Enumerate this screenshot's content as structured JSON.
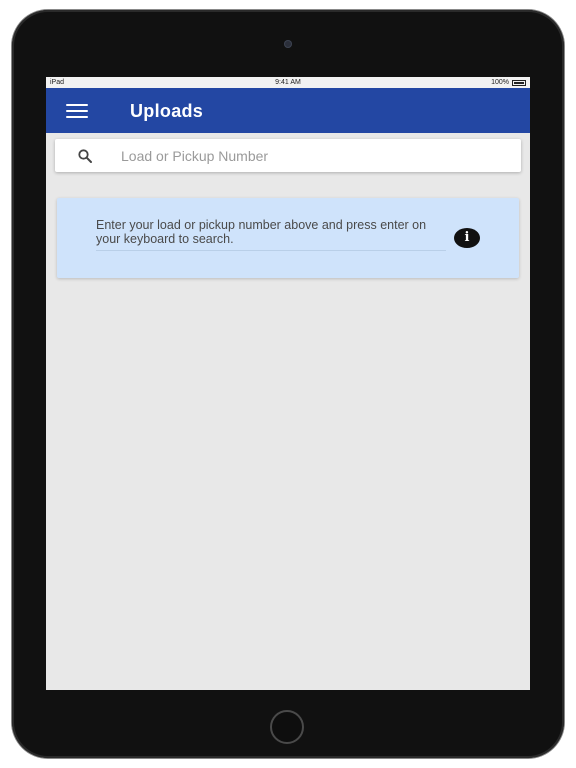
{
  "status_bar": {
    "device": "iPad",
    "time": "9:41 AM",
    "battery": "100%"
  },
  "app_bar": {
    "title": "Uploads",
    "color": "#2347a3"
  },
  "search": {
    "placeholder": "Load or Pickup Number",
    "value": ""
  },
  "info_card": {
    "message": "Enter your load or pickup number above and press enter on your keyboard to search.",
    "icon": "info-icon",
    "background": "#cfe3fb"
  },
  "icons": {
    "menu": "menu-icon",
    "search": "search-icon"
  }
}
